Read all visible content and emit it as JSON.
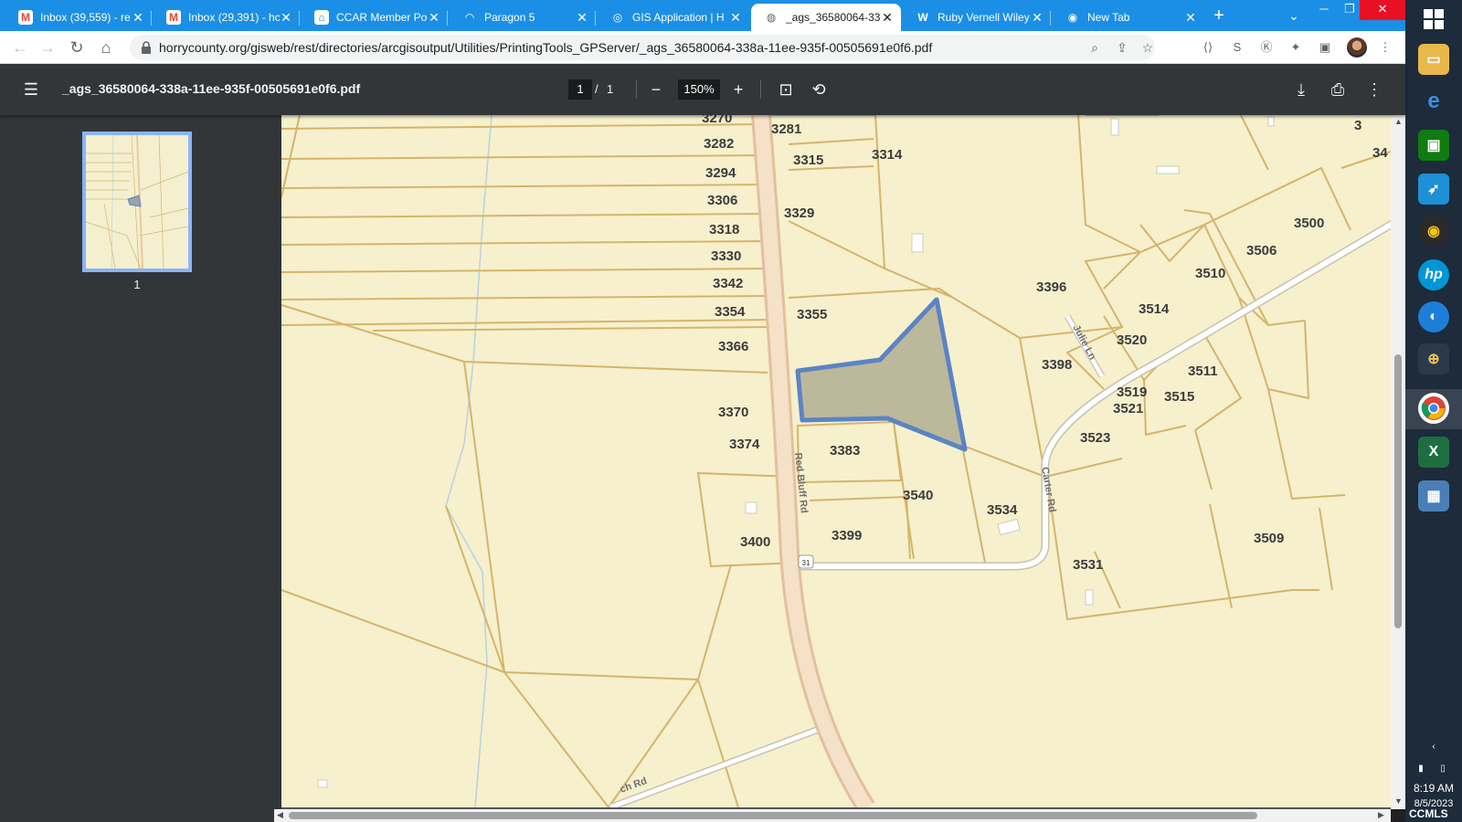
{
  "browser": {
    "tabs": [
      {
        "title": "Inbox (39,559) - re",
        "icon": "gmail-icon"
      },
      {
        "title": "Inbox (29,391) - hc",
        "icon": "gmail-icon"
      },
      {
        "title": "CCAR Member Por",
        "icon": "ccar-icon"
      },
      {
        "title": "Paragon 5",
        "icon": "paragon-icon"
      },
      {
        "title": "GIS Application | H",
        "icon": "gis-icon"
      },
      {
        "title": "_ags_36580064-33",
        "icon": "globe-icon",
        "active": true
      },
      {
        "title": "Ruby Vernell Wiley",
        "icon": "w-icon"
      },
      {
        "title": "New Tab",
        "icon": "chrome-icon"
      }
    ],
    "new_tab_symbol": "+",
    "url": "horrycounty.org/gisweb/rest/directories/arcgisoutput/Utilities/PrintingTools_GPServer/_ags_36580064-338a-11ee-935f-00505691e0f6.pdf"
  },
  "pdf": {
    "filename": "_ags_36580064-338a-11ee-935f-00505691e0f6.pdf",
    "current_page": "1",
    "page_separator": "/",
    "total_pages": "1",
    "zoom": "150%",
    "thumbnail_label": "1"
  },
  "map": {
    "parcel_labels": [
      "3270",
      "3281",
      "3282",
      "3315",
      "3314",
      "3294",
      "3306",
      "3329",
      "3318",
      "3330",
      "3342",
      "3354",
      "3355",
      "3366",
      "3370",
      "3374",
      "3383",
      "3540",
      "3534",
      "3399",
      "3400",
      "3396",
      "3398",
      "3500",
      "3506",
      "3510",
      "3514",
      "3520",
      "3511",
      "3519",
      "3521",
      "3515",
      "3523",
      "3509",
      "3531",
      "3",
      "34"
    ],
    "road_labels": [
      "Red Bluff Rd",
      "Carter Rd",
      "Julie Ln",
      "ch Rd"
    ],
    "route_shield": "31",
    "highlight_color": "#5b84c4",
    "map_background": "#f6f0cd",
    "parcel_line_color": "#d6b469"
  },
  "taskbar": {
    "time": "8:19 AM",
    "date": "8/5/2023",
    "brand": "CCMLS"
  }
}
